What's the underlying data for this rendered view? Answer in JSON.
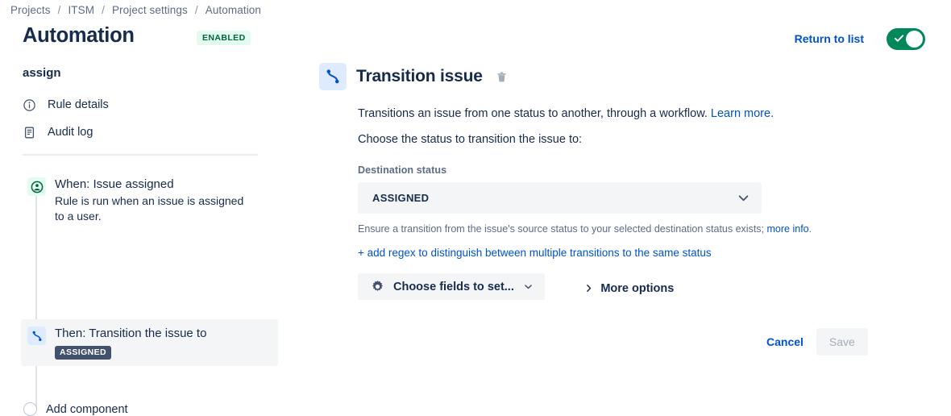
{
  "breadcrumb": {
    "items": [
      "Projects",
      "ITSM",
      "Project settings",
      "Automation"
    ],
    "separator": "/"
  },
  "header": {
    "title": "Automation",
    "status_badge": "ENABLED",
    "return_link": "Return to list",
    "toggle_state": "on",
    "colors": {
      "badge_bg": "#e3fcef",
      "badge_text": "#006644",
      "toggle_on": "#00875a",
      "link": "#0052cc"
    }
  },
  "sidebar": {
    "title": "assign",
    "nav": [
      {
        "label": "Rule details",
        "icon": "info-circle-icon"
      },
      {
        "label": "Audit log",
        "icon": "document-list-icon"
      }
    ],
    "steps": [
      {
        "title": "When: Issue assigned",
        "description": "Rule is run when an issue is assigned to a user.",
        "icon": "person-circle-icon",
        "selected": false
      },
      {
        "title": "Then: Transition the issue to",
        "badge": "ASSIGNED",
        "icon": "transition-icon",
        "selected": true
      }
    ],
    "add_component": {
      "label": "Add component",
      "icon": "empty-circle-icon"
    }
  },
  "main": {
    "icon": "transition-icon",
    "title": "Transition issue",
    "delete_icon": "trash-icon",
    "description": "Transitions an issue from one status to another, through a workflow.",
    "description_link": "Learn more.",
    "subheading": "Choose the status to transition the issue to:",
    "destination": {
      "label": "Destination status",
      "value": "ASSIGNED",
      "chevron": "chevron-down-icon"
    },
    "help_text": "Ensure a transition from the issue's source status to your selected destination status exists;",
    "help_link": "more info",
    "help_suffix": ".",
    "regex_link": "+ add regex to distinguish between multiple transitions to the same status",
    "fields_button": {
      "label": "Choose fields to set...",
      "icon": "gear-icon",
      "chevron": "chevron-down-icon"
    },
    "more_options": {
      "label": "More options",
      "chevron": "chevron-right-icon"
    },
    "actions": {
      "cancel": "Cancel",
      "save": "Save",
      "save_disabled": true
    }
  }
}
